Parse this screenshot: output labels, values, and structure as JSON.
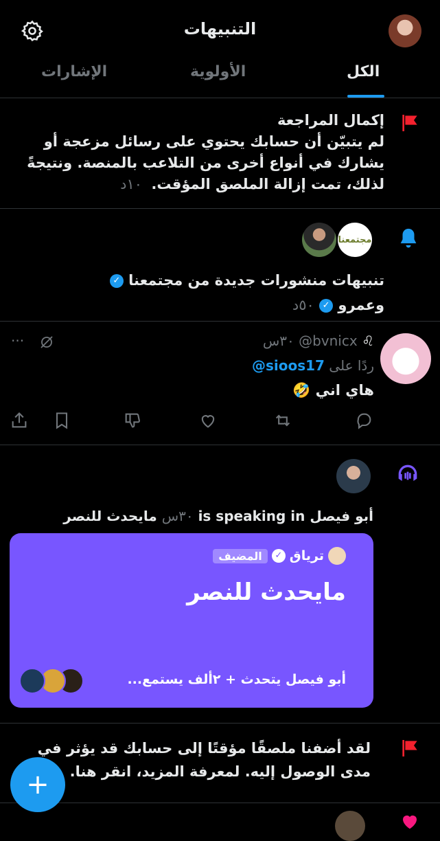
{
  "header": {
    "title": "التنبيهات"
  },
  "tabs": [
    {
      "label": "الكل"
    },
    {
      "label": "الأولوية"
    },
    {
      "label": "الإشارات"
    }
  ],
  "notif1": {
    "title": "إكمال المراجعة",
    "body": "لم يتبيّن أن حسابك يحتوي على رسائل مزعجة أو يشارك في أنواع أخرى من التلاعب بالمنصة. ونتيجةً لذلك، تمت إزالة الملصق المؤقت.",
    "time": "١٠د",
    "flag_color": "#f4212e"
  },
  "notif2": {
    "community_logo_text": "مجتمعنا",
    "text": "تنبيهات منشورات جديدة من مجتمعنا",
    "author": "وعمرو",
    "time": "٥٠د",
    "bell_color": "#1d9bf0"
  },
  "tweet": {
    "zodiac": "♌",
    "handle": "@bvnicx",
    "time": "٣٠س",
    "reply_prefix": "ردًا على",
    "reply_to": "@sioos17",
    "text": "هاي اني",
    "emoji": "🤣",
    "more": "···"
  },
  "space": {
    "header_speaker": "أبو فيصل",
    "header_verb": "is speaking in",
    "header_time": "٣٠س",
    "header_title": "مايحدث للنصر",
    "card_color": "#7856ff",
    "host_name": "ترياق",
    "host_badge": "المضيف",
    "title": "مايحدث للنصر",
    "footer": "أبو فيصل يتحدث + ٢ألف يستمع..."
  },
  "notif4": {
    "text": "لقد أضفنا ملصقًا مؤقتًا إلى حسابك قد يؤثر في مدى الوصول إليه. لمعرفة المزيد، انقر هنا."
  },
  "fab": {
    "label": "+",
    "color": "#1d9bf0"
  }
}
